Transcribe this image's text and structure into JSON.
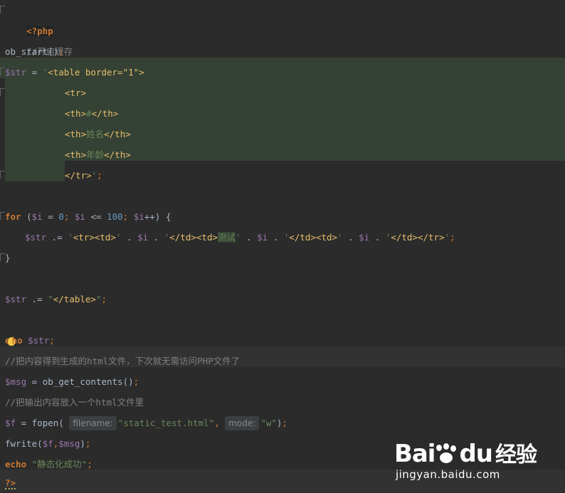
{
  "editor": {
    "php_open": "<?php",
    "cmt_cache": "//开启缓存",
    "ob_start": "ob_start",
    "str_var": "$str",
    "table_tag": "<table border=\"1\">",
    "tr_open": "<tr>",
    "th_open": "<th>",
    "th_close": "</th>",
    "th1": "#",
    "th2": "姓名",
    "th3": "年龄",
    "tr_close": "</tr>",
    "for_kw": "for",
    "i_var": "$i",
    "num0": "0",
    "num100": "100",
    "td_open": "<td>",
    "td_close": "</td>",
    "test_text": "测试",
    "table_close": "</table>",
    "echo_kw": "echo",
    "cmt_save": "//把内容得到生成的html文件，下次就无需访问PHP文件了",
    "msg_var": "$msg",
    "ob_get": "ob_get_contents",
    "cmt_put": "//把输出内容放入一个html文件里",
    "f_var": "$f",
    "fopen": "fopen",
    "hint_filename": "filename:",
    "file_name": "\"static_test.html\"",
    "hint_mode": "mode:",
    "mode_value": "\"w\"",
    "fwrite": "fwrite",
    "success_str": "\"静态化成功\"",
    "php_close": "?>"
  },
  "watermark": {
    "brand": "Bai",
    "brand2": "du",
    "jingyan": "经验",
    "url": "jingyan.baidu.com"
  }
}
